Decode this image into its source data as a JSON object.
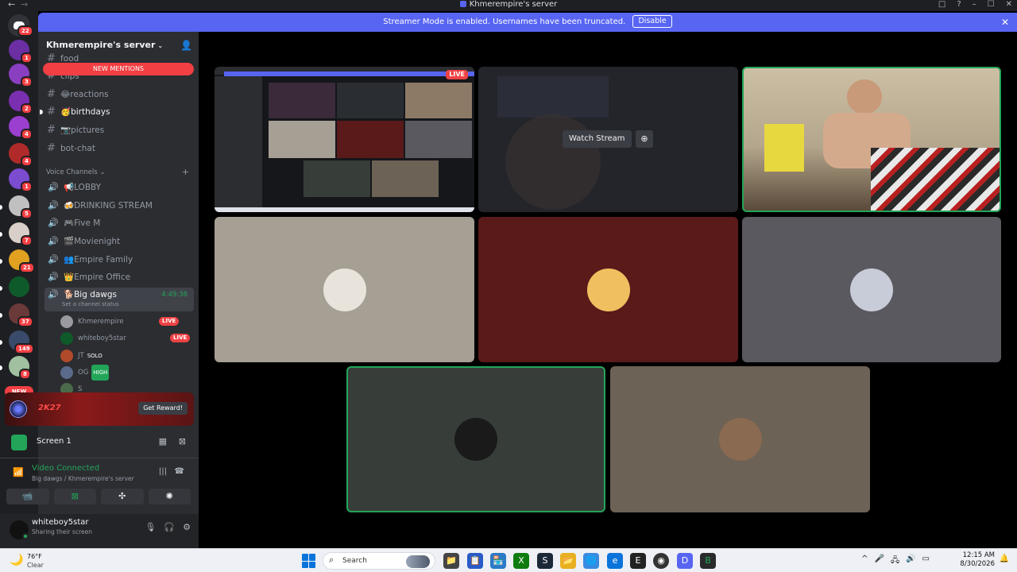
{
  "titlebar": {
    "title": "Khmerempire's server",
    "back": "←",
    "fwd": "→",
    "icons": [
      "□",
      "?",
      "–",
      "☐",
      "✕"
    ]
  },
  "banner": {
    "text": "Streamer Mode is enabled. Usernames have been truncated.",
    "button": "Disable",
    "close": "✕"
  },
  "rail": {
    "home_badge": "22",
    "servers": [
      {
        "color": "#6b2fa3",
        "badge": "1"
      },
      {
        "color": "#8a3fc0",
        "badge": "3"
      },
      {
        "color": "#7a2fb0",
        "badge": "2"
      },
      {
        "color": "#9a3fd0",
        "badge": "4"
      },
      {
        "color": "#b02a2a",
        "badge": "4"
      },
      {
        "color": "#7b4bd0",
        "badge": "1"
      },
      {
        "color": "#c0c0c0",
        "badge": "5"
      },
      {
        "color": "#d8d0c8",
        "badge": "7"
      },
      {
        "color": "#e0a020",
        "badge": "21"
      },
      {
        "color": "#0f5a2a",
        "badge": ""
      },
      {
        "color": "#6a3a3a",
        "badge": "37"
      },
      {
        "color": "#3a4a6a",
        "badge": "149"
      },
      {
        "color": "#a0c0a0",
        "badge": "8"
      }
    ],
    "new_label": "NEW"
  },
  "sidebar": {
    "server_name": "Khmerempire's server",
    "new_mentions": "NEW MENTIONS",
    "channels": [
      {
        "name": "food",
        "emoji": ""
      },
      {
        "name": "clips",
        "emoji": ""
      },
      {
        "name": "reactions",
        "emoji": "😂"
      },
      {
        "name": "birthdays",
        "emoji": "🥳"
      },
      {
        "name": "pictures",
        "emoji": "📷"
      },
      {
        "name": "bot-chat",
        "emoji": ""
      }
    ],
    "voice_category": "Voice Channels",
    "voice_channels": [
      {
        "name": "LOBBY",
        "emoji": "📢"
      },
      {
        "name": "DRINKING STREAM",
        "emoji": "🍻"
      },
      {
        "name": "Five M",
        "emoji": "🎮"
      },
      {
        "name": "Movienight",
        "emoji": "🎬"
      },
      {
        "name": "Empire Family",
        "emoji": "👥"
      },
      {
        "name": "Empire Office",
        "emoji": "👑"
      }
    ],
    "active_channel": {
      "name": "Big dawgs",
      "emoji": "🐕",
      "timer": "4:49:36",
      "status": "Set a channel status"
    },
    "members": [
      {
        "name": "Khmerempire",
        "tag": "LIVE",
        "color": "#9a9aa0"
      },
      {
        "name": "whiteboy5star",
        "tag": "LIVE",
        "color": "#0f5a2a"
      },
      {
        "name": "JT",
        "tag": "SOLO",
        "color": "#b04a2a"
      },
      {
        "name": "OG",
        "tag": "HIGH",
        "color": "#5a6a8a"
      },
      {
        "name": "S",
        "tag": "",
        "color": "#4a6a4a"
      }
    ],
    "reward": {
      "brand": "2K27",
      "button": "Get Reward!"
    },
    "activity": {
      "label": "Screen 1"
    },
    "voice_conn": {
      "title": "Video Connected",
      "subtitle": "Big dawgs / Khmerempire's server"
    },
    "user": {
      "name": "whiteboy5star",
      "status": "Sharing their screen"
    }
  },
  "stage": {
    "live_label": "LIVE",
    "watch_label": "Watch Stream",
    "tile_colors": {
      "t4": "#a69f94",
      "t5": "#5a1a1a",
      "t6": "#5b5960",
      "t7": "#373e3a",
      "t8": "#6c6255"
    }
  },
  "taskbar": {
    "temp": "76°F",
    "condition": "Clear",
    "search": "Search",
    "time": "12:15 AM",
    "date": "8/30/2026",
    "apps": [
      "📁",
      "📋",
      "🏪",
      "X",
      "S",
      "📂",
      "🌐",
      "e",
      "E",
      "◉",
      "D",
      "B"
    ]
  }
}
